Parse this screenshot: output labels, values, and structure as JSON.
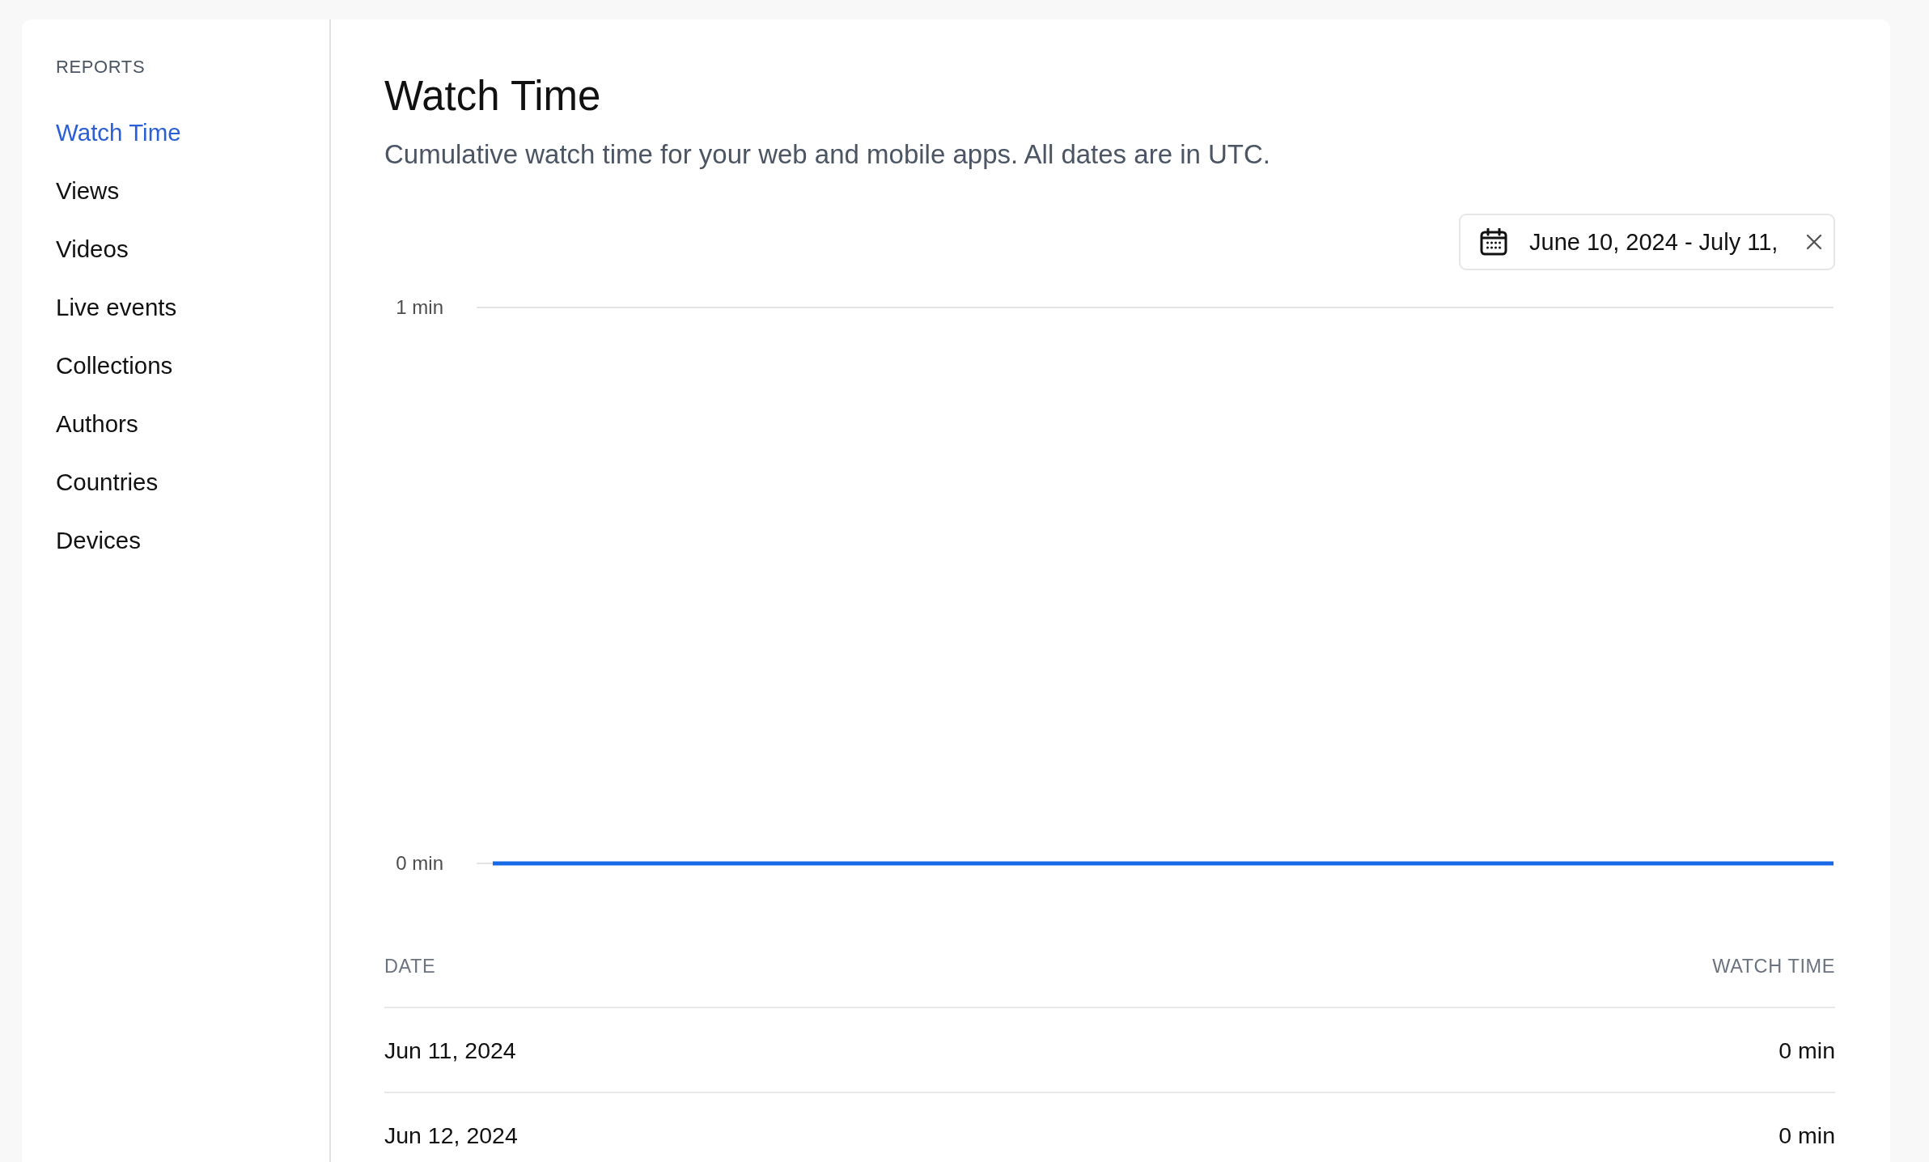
{
  "sidebar": {
    "heading": "REPORTS",
    "items": [
      {
        "label": "Watch Time",
        "selected": true
      },
      {
        "label": "Views",
        "selected": false
      },
      {
        "label": "Videos",
        "selected": false
      },
      {
        "label": "Live events",
        "selected": false
      },
      {
        "label": "Collections",
        "selected": false
      },
      {
        "label": "Authors",
        "selected": false
      },
      {
        "label": "Countries",
        "selected": false
      },
      {
        "label": "Devices",
        "selected": false
      }
    ]
  },
  "header": {
    "title": "Watch Time",
    "subtitle": "Cumulative watch time for your web and mobile apps. All dates are in UTC."
  },
  "date_range": {
    "value": "June 10, 2024 - July 11,"
  },
  "chart": {
    "chart_data": {
      "type": "line",
      "ylim": [
        0,
        1
      ],
      "yticks": [
        {
          "value": 0,
          "label": "0 min"
        },
        {
          "value": 1,
          "label": "1 min"
        }
      ],
      "series": [
        {
          "color": "#1769e8",
          "values": [
            0,
            0,
            0,
            0,
            0,
            0,
            0,
            0,
            0,
            0,
            0,
            0,
            0,
            0,
            0,
            0,
            0,
            0,
            0,
            0,
            0,
            0,
            0,
            0,
            0,
            0,
            0,
            0,
            0,
            0,
            0
          ]
        }
      ]
    }
  },
  "table": {
    "columns": [
      "DATE",
      "WATCH TIME"
    ],
    "rows": [
      [
        "Jun 11, 2024",
        "0 min"
      ],
      [
        "Jun 12, 2024",
        "0 min"
      ]
    ]
  }
}
